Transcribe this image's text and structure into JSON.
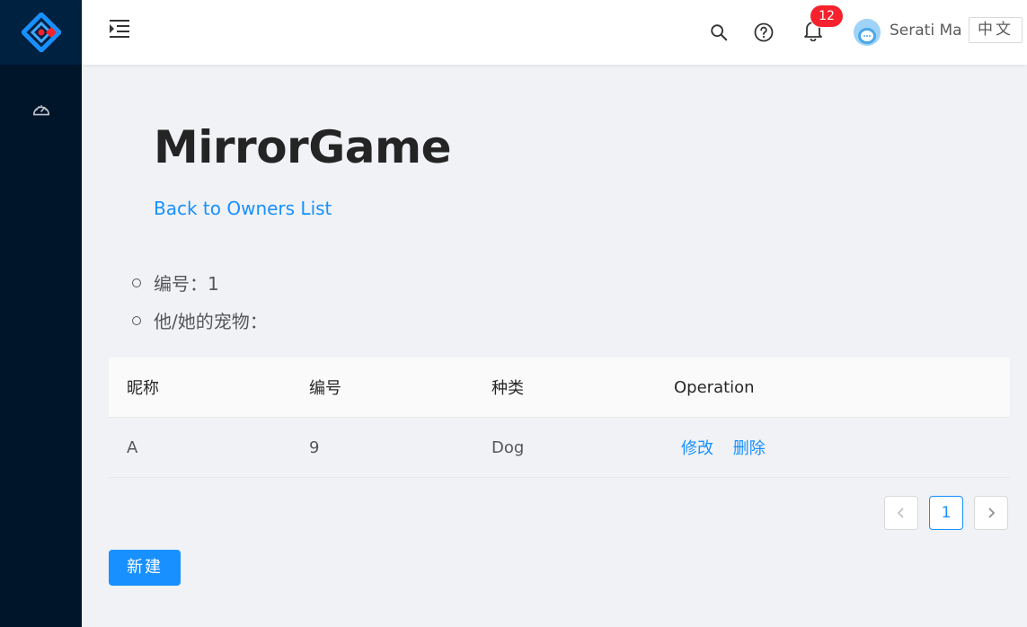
{
  "header": {
    "notification_count": "12",
    "user_name": "Serati Ma",
    "lang_label": "中文"
  },
  "main": {
    "title": "MirrorGame",
    "back_link": "Back to Owners List",
    "info": [
      {
        "text": "编号：1"
      },
      {
        "text": "他/她的宠物："
      }
    ]
  },
  "table": {
    "columns": [
      "昵称",
      "编号",
      "种类",
      "Operation"
    ],
    "rows": [
      {
        "name": "A",
        "id": "9",
        "type": "Dog",
        "edit": "修改",
        "delete": "删除"
      }
    ]
  },
  "pagination": {
    "current_page": "1"
  },
  "actions": {
    "new_label": "新建"
  },
  "colors": {
    "primary": "#1890ff",
    "sider": "#001529",
    "badge": "#f5222d"
  }
}
